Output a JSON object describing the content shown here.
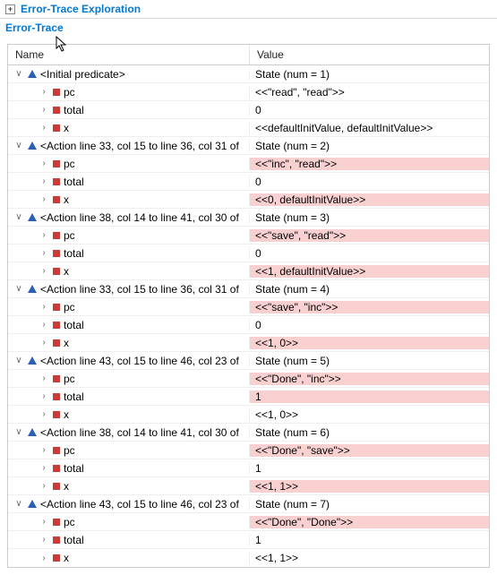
{
  "headers": {
    "exploration": "Error-Trace Exploration",
    "trace": "Error-Trace"
  },
  "columns": {
    "name": "Name",
    "value": "Value"
  },
  "states": [
    {
      "label": "<Initial predicate>",
      "value": "State (num = 1)",
      "vars": [
        {
          "name": "pc",
          "value": "<<\"read\", \"read\">>",
          "changed": false
        },
        {
          "name": "total",
          "value": "0",
          "changed": false
        },
        {
          "name": "x",
          "value": "<<defaultInitValue, defaultInitValue>>",
          "changed": false
        }
      ]
    },
    {
      "label": "<Action line 33, col 15 to line 36, col 31 of",
      "value": "State (num = 2)",
      "vars": [
        {
          "name": "pc",
          "value": "<<\"inc\", \"read\">>",
          "changed": true
        },
        {
          "name": "total",
          "value": "0",
          "changed": false
        },
        {
          "name": "x",
          "value": "<<0, defaultInitValue>>",
          "changed": true
        }
      ]
    },
    {
      "label": "<Action line 38, col 14 to line 41, col 30 of",
      "value": "State (num = 3)",
      "vars": [
        {
          "name": "pc",
          "value": "<<\"save\", \"read\">>",
          "changed": true
        },
        {
          "name": "total",
          "value": "0",
          "changed": false
        },
        {
          "name": "x",
          "value": "<<1, defaultInitValue>>",
          "changed": true
        }
      ]
    },
    {
      "label": "<Action line 33, col 15 to line 36, col 31 of",
      "value": "State (num = 4)",
      "vars": [
        {
          "name": "pc",
          "value": "<<\"save\", \"inc\">>",
          "changed": true
        },
        {
          "name": "total",
          "value": "0",
          "changed": false
        },
        {
          "name": "x",
          "value": "<<1, 0>>",
          "changed": true
        }
      ]
    },
    {
      "label": "<Action line 43, col 15 to line 46, col 23 of",
      "value": "State (num = 5)",
      "vars": [
        {
          "name": "pc",
          "value": "<<\"Done\", \"inc\">>",
          "changed": true
        },
        {
          "name": "total",
          "value": "1",
          "changed": true
        },
        {
          "name": "x",
          "value": "<<1, 0>>",
          "changed": false
        }
      ]
    },
    {
      "label": "<Action line 38, col 14 to line 41, col 30 of",
      "value": "State (num = 6)",
      "vars": [
        {
          "name": "pc",
          "value": "<<\"Done\", \"save\">>",
          "changed": true
        },
        {
          "name": "total",
          "value": "1",
          "changed": false
        },
        {
          "name": "x",
          "value": "<<1, 1>>",
          "changed": true
        }
      ]
    },
    {
      "label": "<Action line 43, col 15 to line 46, col 23 of",
      "value": "State (num = 7)",
      "vars": [
        {
          "name": "pc",
          "value": "<<\"Done\", \"Done\">>",
          "changed": true
        },
        {
          "name": "total",
          "value": "1",
          "changed": false
        },
        {
          "name": "x",
          "value": "<<1, 1>>",
          "changed": false
        }
      ]
    }
  ]
}
